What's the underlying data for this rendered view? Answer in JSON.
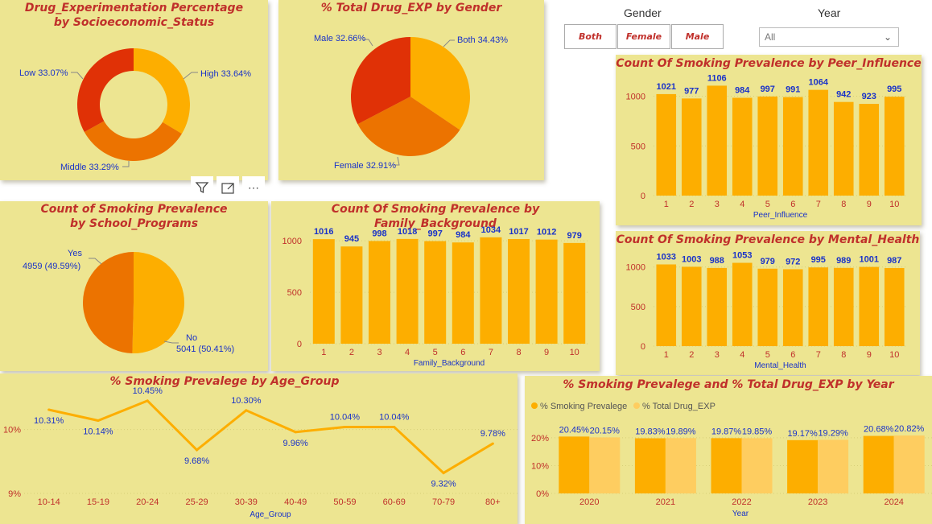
{
  "slicers": {
    "gender": {
      "title": "Gender",
      "buttons": [
        "Both",
        "Female",
        "Male"
      ]
    },
    "year": {
      "title": "Year",
      "selected": "All"
    }
  },
  "icons": {
    "filter": "filter-icon",
    "focus": "focus-mode-icon",
    "more": "more-options-icon"
  },
  "colors": {
    "card_bg": "#ede591",
    "title_red": "#c0302b",
    "label_blue": "#1a33c8",
    "bar_orange": "#fdae00",
    "bar_light": "#fecd60",
    "pie_red": "#e03106",
    "pie_dark_orange": "#ec7300"
  },
  "charts": {
    "socio": {
      "title": "Drug_Experimentation Percentage by Socioeconomic_Status",
      "labels": [
        "High 33.64%",
        "Middle 33.29%",
        "Low 33.07%"
      ]
    },
    "gender_pie": {
      "title": "% Total Drug_EXP by Gender",
      "labels": [
        "Both 34.43%",
        "Female 32.91%",
        "Male 32.66%"
      ]
    },
    "school": {
      "title": "Count of Smoking Prevalence by School_Programs",
      "yes_label": "Yes",
      "yes_value": "4959 (49.59%)",
      "no_label": "No",
      "no_value": "5041 (50.41%)"
    },
    "family": {
      "title": "Count Of Smoking Prevalence by Family_Background",
      "xlabel": "Family_Background"
    },
    "peer": {
      "title": "Count Of Smoking Prevalence by Peer_Influence",
      "xlabel": "Peer_Influence"
    },
    "mental": {
      "title": "Count Of Smoking Prevalence by Mental_Health",
      "xlabel": "Mental_Health"
    },
    "age": {
      "title": "% Smoking Prevalege by Age_Group",
      "xlabel": "Age_Group"
    },
    "year": {
      "title": "% Smoking Prevalege and % Total Drug_EXP by Year",
      "xlabel": "Year",
      "legend": [
        "% Smoking Prevalege",
        "% Total Drug_EXP"
      ]
    }
  },
  "chart_data": [
    {
      "id": "socio",
      "type": "pie",
      "title": "Drug_Experimentation Percentage by Socioeconomic_Status",
      "donut": true,
      "categories": [
        "High",
        "Middle",
        "Low"
      ],
      "values": [
        33.64,
        33.29,
        33.07
      ],
      "colors": [
        "#fdae00",
        "#ec7300",
        "#e03106"
      ]
    },
    {
      "id": "gender_pie",
      "type": "pie",
      "title": "% Total Drug_EXP by Gender",
      "categories": [
        "Both",
        "Female",
        "Male"
      ],
      "values": [
        34.43,
        32.91,
        32.66
      ],
      "colors": [
        "#fdae00",
        "#ec7300",
        "#e03106"
      ]
    },
    {
      "id": "school",
      "type": "pie",
      "title": "Count of Smoking Prevalence by School_Programs",
      "categories": [
        "No",
        "Yes"
      ],
      "values": [
        5041,
        4959
      ],
      "percent": [
        50.41,
        49.59
      ],
      "colors": [
        "#fdae00",
        "#ec7300"
      ]
    },
    {
      "id": "family",
      "type": "bar",
      "title": "Count Of Smoking Prevalence by Family_Background",
      "xlabel": "Family_Background",
      "categories": [
        "1",
        "2",
        "3",
        "4",
        "5",
        "6",
        "7",
        "8",
        "9",
        "10"
      ],
      "values": [
        1016,
        945,
        998,
        1018,
        997,
        984,
        1034,
        1017,
        1012,
        979
      ],
      "yticks": [
        0,
        500,
        1000
      ],
      "ylim": [
        0,
        1150
      ]
    },
    {
      "id": "peer",
      "type": "bar",
      "title": "Count Of Smoking Prevalence by Peer_Influence",
      "xlabel": "Peer_Influence",
      "categories": [
        "1",
        "2",
        "3",
        "4",
        "5",
        "6",
        "7",
        "8",
        "9",
        "10"
      ],
      "values": [
        1021,
        977,
        1106,
        984,
        997,
        991,
        1064,
        942,
        923,
        995
      ],
      "yticks": [
        0,
        500,
        1000
      ],
      "ylim": [
        0,
        1150
      ]
    },
    {
      "id": "mental",
      "type": "bar",
      "title": "Count Of Smoking Prevalence by Mental_Health",
      "xlabel": "Mental_Health",
      "categories": [
        "1",
        "2",
        "3",
        "4",
        "5",
        "6",
        "7",
        "8",
        "9",
        "10"
      ],
      "values": [
        1033,
        1003,
        988,
        1053,
        979,
        972,
        995,
        989,
        1001,
        987
      ],
      "yticks": [
        0,
        500,
        1000
      ],
      "ylim": [
        0,
        1150
      ]
    },
    {
      "id": "age",
      "type": "line",
      "title": "% Smoking Prevalege by Age_Group",
      "xlabel": "Age_Group",
      "categories": [
        "10-14",
        "15-19",
        "20-24",
        "25-29",
        "30-39",
        "40-49",
        "50-59",
        "60-69",
        "70-79",
        "80+"
      ],
      "values": [
        10.31,
        10.14,
        10.45,
        9.68,
        10.3,
        9.96,
        10.04,
        10.04,
        9.32,
        9.78
      ],
      "labels": [
        "10.31%",
        "10.14%",
        "10.45%",
        "9.68%",
        "10.30%",
        "9.96%",
        "10.04%",
        "10.04%",
        "9.32%",
        "9.78%"
      ],
      "yticks": [
        9,
        10
      ],
      "ytick_labels": [
        "9%",
        "10%"
      ],
      "ylim": [
        9,
        10.6
      ]
    },
    {
      "id": "year",
      "type": "bar",
      "title": "% Smoking Prevalege and % Total Drug_EXP by Year",
      "xlabel": "Year",
      "categories": [
        "2020",
        "2021",
        "2022",
        "2023",
        "2024"
      ],
      "series": [
        {
          "name": "% Smoking Prevalege",
          "values": [
            20.45,
            19.83,
            19.87,
            19.17,
            20.68
          ],
          "labels": [
            "20.45%",
            "19.83%",
            "19.87%",
            "19.17%",
            "20.68%"
          ]
        },
        {
          "name": "% Total Drug_EXP",
          "values": [
            20.15,
            19.89,
            19.85,
            19.29,
            20.82
          ],
          "labels": [
            "20.15%",
            "19.89%",
            "19.85%",
            "19.29%",
            "20.82%"
          ]
        }
      ],
      "yticks": [
        0,
        10,
        20
      ],
      "ytick_labels": [
        "0%",
        "10%",
        "20%"
      ],
      "ylim": [
        0,
        22
      ]
    }
  ]
}
